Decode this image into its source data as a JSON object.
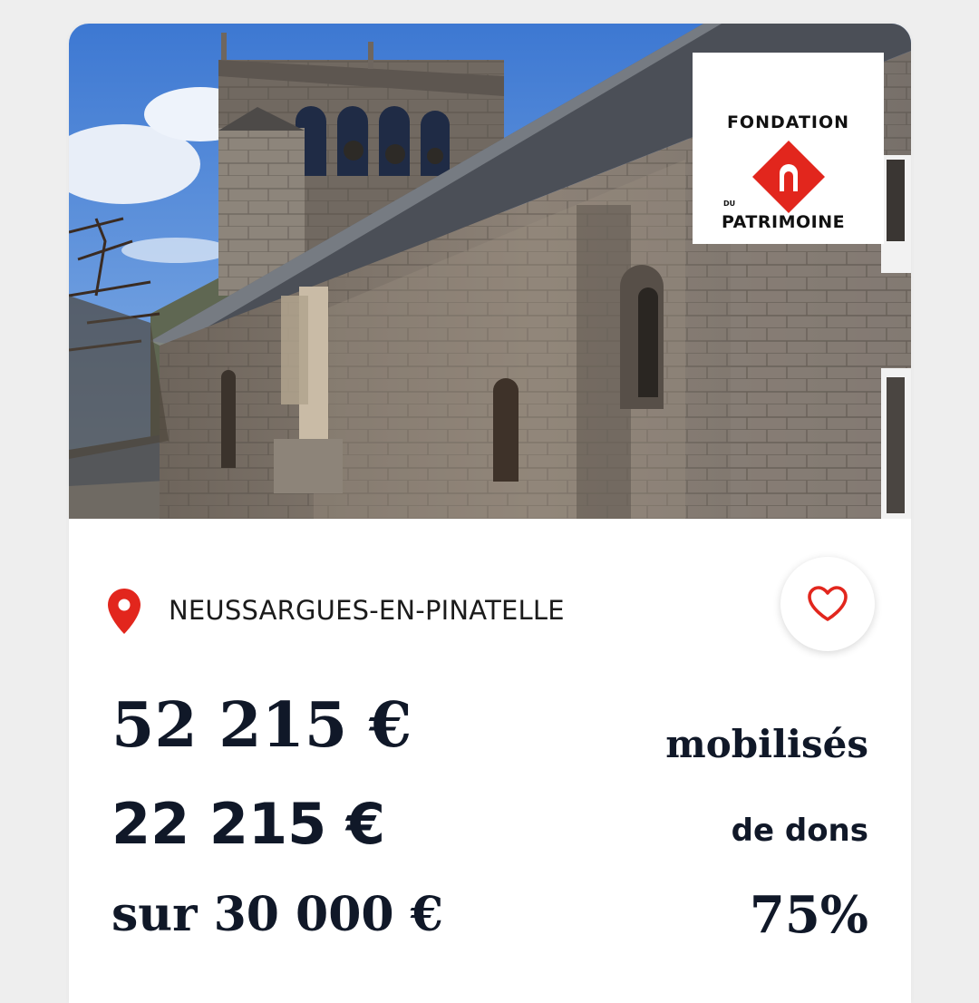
{
  "project": {
    "image_alt": "",
    "logo": {
      "line1": "FONDATION",
      "small": "DU",
      "line2": "PATRIMOINE",
      "icon": "fondation-patrimoine-logo",
      "color": "#e2261d"
    },
    "location": {
      "icon": "map-pin-icon",
      "name": "NEUSSARGUES-EN-PINATELLE",
      "color": "#e2261d"
    },
    "favorite": {
      "icon": "heart-icon",
      "color": "#e2261d"
    },
    "funding": {
      "raised_amount": "52 215 €",
      "raised_label": "mobilisés",
      "donations_amount": "22 215 €",
      "donations_label": "de dons",
      "goal": "sur 30 000 €",
      "percent": "75%"
    }
  }
}
